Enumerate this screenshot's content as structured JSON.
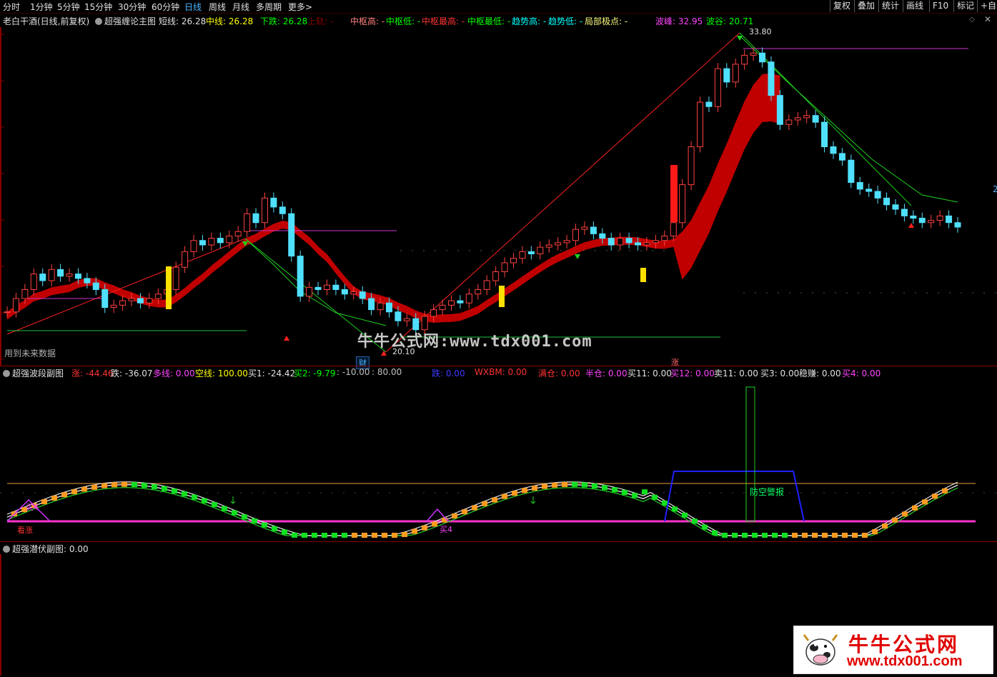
{
  "toolbar": {
    "periods": [
      "分时",
      "1分钟",
      "5分钟",
      "15分钟",
      "30分钟",
      "60分钟",
      "日线",
      "周线",
      "月线",
      "多周期",
      "更多>"
    ],
    "active_period": "日线",
    "right_buttons": [
      "复权",
      "叠加",
      "统计",
      "画线",
      "F10",
      "标记",
      "+自"
    ]
  },
  "main_header": {
    "stock": "老白干酒(日线,前复权)",
    "indicator": "超强缠论主图",
    "items": [
      {
        "label": "短线: 26.28",
        "color": "#e0e0e0"
      },
      {
        "label": "中线: 26.28",
        "color": "#ffff00"
      },
      {
        "label": "下跌: 26.28",
        "color": "#00ff00"
      },
      {
        "label": "上轨: -",
        "color": "#8b0000"
      },
      {
        "label": "中枢高: -",
        "color": "#ff8080"
      },
      {
        "label": "中枢低: -",
        "color": "#00ff00"
      },
      {
        "label": "中枢最高: -",
        "color": "#ff3333"
      },
      {
        "label": "中枢最低: -",
        "color": "#00ff00"
      },
      {
        "label": "趋势高: -",
        "color": "#00ffff"
      },
      {
        "label": "趋势低: -",
        "color": "#00ffff"
      },
      {
        "label": "局部极点: -",
        "color": "#ffff80"
      },
      {
        "label": "波峰: 32.95",
        "color": "#ff44ff"
      },
      {
        "label": "波谷: 20.71",
        "color": "#00ff00"
      }
    ]
  },
  "main_chart": {
    "high_label": "33.80",
    "low_label": "20.10",
    "future_data_note": "用到未来数据",
    "tags": [
      {
        "text": "财",
        "color": "#4fb3ff"
      },
      {
        "text": "涨",
        "color": "#ff6666"
      }
    ],
    "right_edge_label": "2",
    "watermark": "牛牛公式网:www.tdx001.com"
  },
  "sub1_header": {
    "indicator": "超强波段副图",
    "items": [
      {
        "label": "涨: -44.46",
        "color": "#ff3333"
      },
      {
        "label": "跌: -36.07",
        "color": "#e0e0e0"
      },
      {
        "label": "多线: 0.00",
        "color": "#ff44ff"
      },
      {
        "label": "空线: 100.00",
        "color": "#ffff00"
      },
      {
        "label": "买1: -24.42",
        "color": "#e0e0e0"
      },
      {
        "label": "买2: -9.79",
        "color": "#00ff00"
      },
      {
        "label": ": -10.00",
        "color": "#c0c0c0"
      },
      {
        "label": ": 80.00",
        "color": "#c0c0c0"
      },
      {
        "label": "跌: 0.00",
        "color": "#3a3aff"
      },
      {
        "label": "WXBM: 0.00",
        "color": "#ff3333"
      },
      {
        "label": "满仓: 0.00",
        "color": "#ff3333"
      },
      {
        "label": "半仓: 0.00",
        "color": "#ff44ff"
      },
      {
        "label": "买11: 0.00",
        "color": "#e0e0e0"
      },
      {
        "label": "买12: 0.00",
        "color": "#ff44ff"
      },
      {
        "label": "卖11: 0.00",
        "color": "#e0e0e0"
      },
      {
        "label": "买3: 0.00",
        "color": "#e0e0e0"
      },
      {
        "label": "稳赚: 0.00",
        "color": "#e0e0e0"
      },
      {
        "label": "买4: 0.00",
        "color": "#ff44ff"
      }
    ],
    "labels": {
      "left_a": "看涨",
      "left_b": "买4",
      "mid": "买4",
      "alert": "防空警报"
    }
  },
  "sub2_header": {
    "indicator": "超强潜伏副图",
    "value": ": 0.00"
  },
  "logo": {
    "cn": "牛牛公式网",
    "url": "www.tdx001.com"
  }
}
